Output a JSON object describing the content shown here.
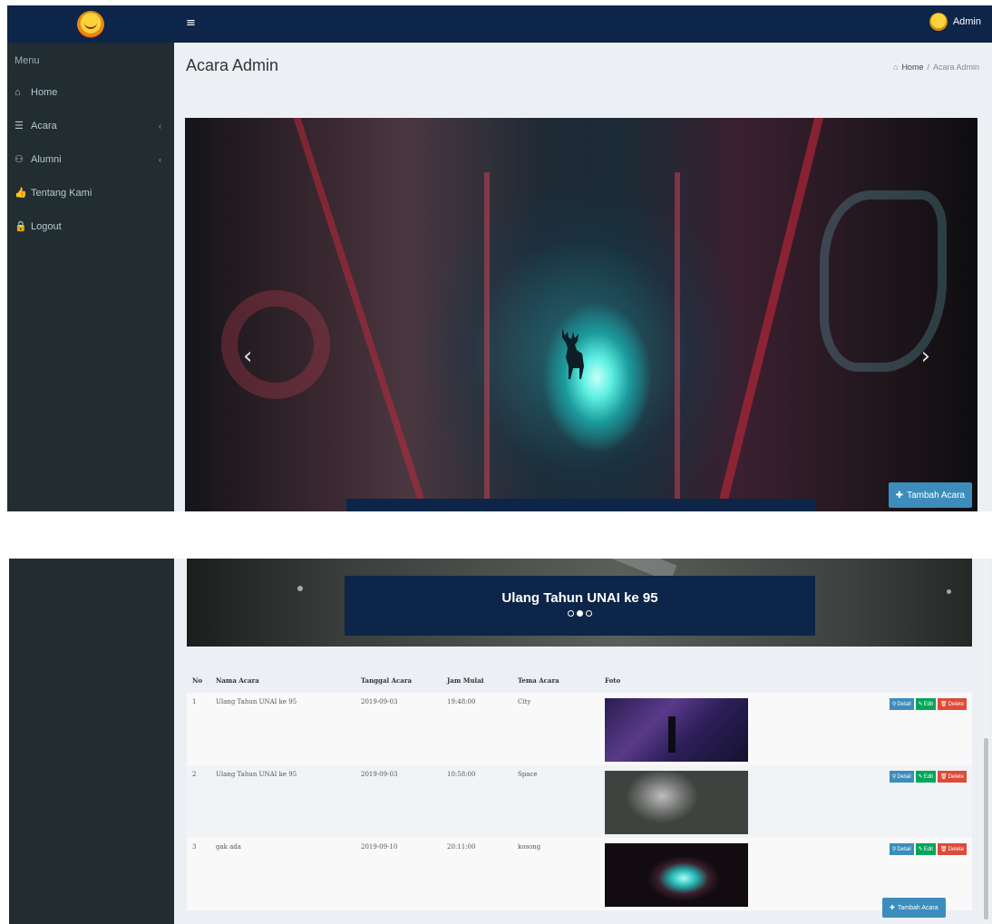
{
  "header": {
    "admin_label": "Admin"
  },
  "sidebar": {
    "menu_header": "Menu",
    "items": [
      {
        "label": "Home",
        "icon": "home-icon"
      },
      {
        "label": "Acara",
        "icon": "list-icon",
        "has_submenu": true
      },
      {
        "label": "Alumni",
        "icon": "users-icon",
        "has_submenu": true
      },
      {
        "label": "Tentang Kami",
        "icon": "thumbs-up-icon"
      },
      {
        "label": "Logout",
        "icon": "lock-icon"
      }
    ]
  },
  "page": {
    "title": "Acara Admin",
    "breadcrumb": [
      "Home",
      "Acara Admin"
    ]
  },
  "carousel": {
    "caption_title": "Ulang Tahun UNAI ke 95",
    "prev_glyph": "‹",
    "next_glyph": "›"
  },
  "add_button": {
    "label": "Tambah Acara"
  },
  "table": {
    "columns": [
      "No",
      "Nama Acara",
      "Tanggal Acara",
      "Jam Mulai",
      "Tema Acara",
      "Foto"
    ],
    "rows": [
      {
        "no": "1",
        "nama": "Ulang Tahun UNAI ke 95",
        "tanggal": "2019-09-03",
        "jam": "19:48:00",
        "tema": "City"
      },
      {
        "no": "2",
        "nama": "Ulang Tahun UNAI ke 95",
        "tanggal": "2019-09-03",
        "jam": "10:58:00",
        "tema": "Space"
      },
      {
        "no": "3",
        "nama": "gak ada",
        "tanggal": "2019-09-10",
        "jam": "20:11:00",
        "tema": "kosong"
      }
    ],
    "actions": {
      "detail": "Detail",
      "edit": "Edit",
      "delete": "Delete"
    }
  },
  "colors": {
    "topbar": "#0c2548",
    "sidebar": "#222d32",
    "primary": "#3c8dbc",
    "success": "#00a65a",
    "danger": "#dd4b39"
  }
}
